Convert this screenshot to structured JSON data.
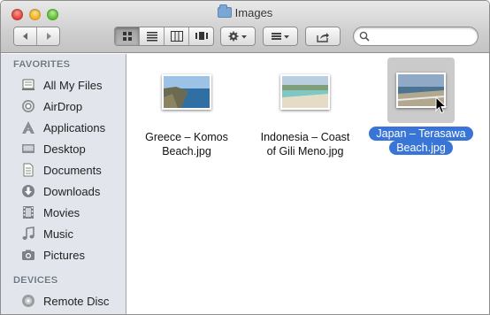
{
  "window": {
    "title": "Images"
  },
  "toolbar": {
    "back_icon": "chevron-left-icon",
    "forward_icon": "chevron-right-icon",
    "view_modes": [
      "icon-view",
      "list-view",
      "column-view",
      "cover-flow-view"
    ],
    "active_view": "icon-view",
    "action_icon": "gear-icon",
    "arrange_icon": "arrange-grid-icon",
    "share_icon": "share-icon",
    "search": {
      "value": "",
      "placeholder": ""
    }
  },
  "sidebar": {
    "favorites_label": "FAVORITES",
    "favorites": [
      {
        "label": "All My Files",
        "icon": "all-files-icon"
      },
      {
        "label": "AirDrop",
        "icon": "airdrop-icon"
      },
      {
        "label": "Applications",
        "icon": "applications-icon"
      },
      {
        "label": "Desktop",
        "icon": "desktop-icon"
      },
      {
        "label": "Documents",
        "icon": "documents-icon"
      },
      {
        "label": "Downloads",
        "icon": "downloads-icon"
      },
      {
        "label": "Movies",
        "icon": "movies-icon"
      },
      {
        "label": "Music",
        "icon": "music-icon"
      },
      {
        "label": "Pictures",
        "icon": "pictures-icon"
      }
    ],
    "devices_label": "DEVICES",
    "devices": [
      {
        "label": "Remote Disc",
        "icon": "remote-disc-icon"
      }
    ]
  },
  "files": [
    {
      "line1": "Greece – Komos",
      "line2": "Beach.jpg",
      "selected": false
    },
    {
      "line1": "Indonesia – Coast",
      "line2": "of Gili Meno.jpg",
      "selected": false
    },
    {
      "line1": "Japan – Terasawa",
      "line2": "Beach.jpg",
      "selected": true
    }
  ],
  "colors": {
    "selection": "#3875d7",
    "sidebar_bg": "#e2e6ec"
  }
}
